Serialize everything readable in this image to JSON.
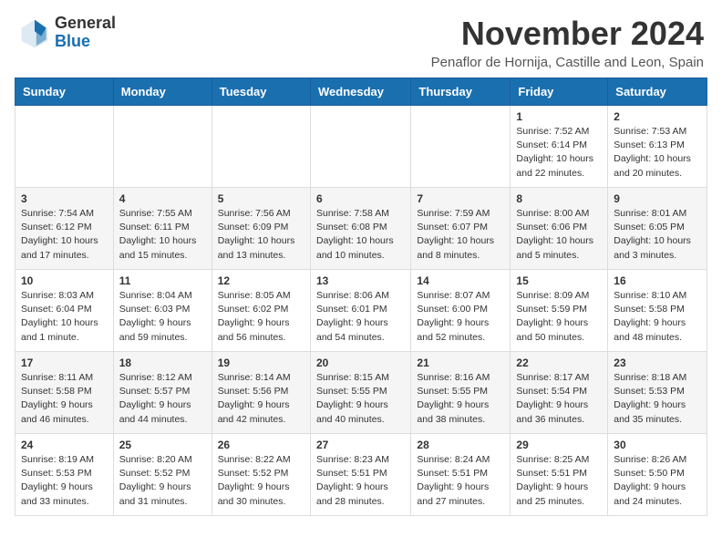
{
  "header": {
    "logo_line1": "General",
    "logo_line2": "Blue",
    "month": "November 2024",
    "location": "Penaflor de Hornija, Castille and Leon, Spain"
  },
  "weekdays": [
    "Sunday",
    "Monday",
    "Tuesday",
    "Wednesday",
    "Thursday",
    "Friday",
    "Saturday"
  ],
  "weeks": [
    [
      {
        "day": "",
        "info": ""
      },
      {
        "day": "",
        "info": ""
      },
      {
        "day": "",
        "info": ""
      },
      {
        "day": "",
        "info": ""
      },
      {
        "day": "",
        "info": ""
      },
      {
        "day": "1",
        "info": "Sunrise: 7:52 AM\nSunset: 6:14 PM\nDaylight: 10 hours\nand 22 minutes."
      },
      {
        "day": "2",
        "info": "Sunrise: 7:53 AM\nSunset: 6:13 PM\nDaylight: 10 hours\nand 20 minutes."
      }
    ],
    [
      {
        "day": "3",
        "info": "Sunrise: 7:54 AM\nSunset: 6:12 PM\nDaylight: 10 hours\nand 17 minutes."
      },
      {
        "day": "4",
        "info": "Sunrise: 7:55 AM\nSunset: 6:11 PM\nDaylight: 10 hours\nand 15 minutes."
      },
      {
        "day": "5",
        "info": "Sunrise: 7:56 AM\nSunset: 6:09 PM\nDaylight: 10 hours\nand 13 minutes."
      },
      {
        "day": "6",
        "info": "Sunrise: 7:58 AM\nSunset: 6:08 PM\nDaylight: 10 hours\nand 10 minutes."
      },
      {
        "day": "7",
        "info": "Sunrise: 7:59 AM\nSunset: 6:07 PM\nDaylight: 10 hours\nand 8 minutes."
      },
      {
        "day": "8",
        "info": "Sunrise: 8:00 AM\nSunset: 6:06 PM\nDaylight: 10 hours\nand 5 minutes."
      },
      {
        "day": "9",
        "info": "Sunrise: 8:01 AM\nSunset: 6:05 PM\nDaylight: 10 hours\nand 3 minutes."
      }
    ],
    [
      {
        "day": "10",
        "info": "Sunrise: 8:03 AM\nSunset: 6:04 PM\nDaylight: 10 hours\nand 1 minute."
      },
      {
        "day": "11",
        "info": "Sunrise: 8:04 AM\nSunset: 6:03 PM\nDaylight: 9 hours\nand 59 minutes."
      },
      {
        "day": "12",
        "info": "Sunrise: 8:05 AM\nSunset: 6:02 PM\nDaylight: 9 hours\nand 56 minutes."
      },
      {
        "day": "13",
        "info": "Sunrise: 8:06 AM\nSunset: 6:01 PM\nDaylight: 9 hours\nand 54 minutes."
      },
      {
        "day": "14",
        "info": "Sunrise: 8:07 AM\nSunset: 6:00 PM\nDaylight: 9 hours\nand 52 minutes."
      },
      {
        "day": "15",
        "info": "Sunrise: 8:09 AM\nSunset: 5:59 PM\nDaylight: 9 hours\nand 50 minutes."
      },
      {
        "day": "16",
        "info": "Sunrise: 8:10 AM\nSunset: 5:58 PM\nDaylight: 9 hours\nand 48 minutes."
      }
    ],
    [
      {
        "day": "17",
        "info": "Sunrise: 8:11 AM\nSunset: 5:58 PM\nDaylight: 9 hours\nand 46 minutes."
      },
      {
        "day": "18",
        "info": "Sunrise: 8:12 AM\nSunset: 5:57 PM\nDaylight: 9 hours\nand 44 minutes."
      },
      {
        "day": "19",
        "info": "Sunrise: 8:14 AM\nSunset: 5:56 PM\nDaylight: 9 hours\nand 42 minutes."
      },
      {
        "day": "20",
        "info": "Sunrise: 8:15 AM\nSunset: 5:55 PM\nDaylight: 9 hours\nand 40 minutes."
      },
      {
        "day": "21",
        "info": "Sunrise: 8:16 AM\nSunset: 5:55 PM\nDaylight: 9 hours\nand 38 minutes."
      },
      {
        "day": "22",
        "info": "Sunrise: 8:17 AM\nSunset: 5:54 PM\nDaylight: 9 hours\nand 36 minutes."
      },
      {
        "day": "23",
        "info": "Sunrise: 8:18 AM\nSunset: 5:53 PM\nDaylight: 9 hours\nand 35 minutes."
      }
    ],
    [
      {
        "day": "24",
        "info": "Sunrise: 8:19 AM\nSunset: 5:53 PM\nDaylight: 9 hours\nand 33 minutes."
      },
      {
        "day": "25",
        "info": "Sunrise: 8:20 AM\nSunset: 5:52 PM\nDaylight: 9 hours\nand 31 minutes."
      },
      {
        "day": "26",
        "info": "Sunrise: 8:22 AM\nSunset: 5:52 PM\nDaylight: 9 hours\nand 30 minutes."
      },
      {
        "day": "27",
        "info": "Sunrise: 8:23 AM\nSunset: 5:51 PM\nDaylight: 9 hours\nand 28 minutes."
      },
      {
        "day": "28",
        "info": "Sunrise: 8:24 AM\nSunset: 5:51 PM\nDaylight: 9 hours\nand 27 minutes."
      },
      {
        "day": "29",
        "info": "Sunrise: 8:25 AM\nSunset: 5:51 PM\nDaylight: 9 hours\nand 25 minutes."
      },
      {
        "day": "30",
        "info": "Sunrise: 8:26 AM\nSunset: 5:50 PM\nDaylight: 9 hours\nand 24 minutes."
      }
    ]
  ]
}
